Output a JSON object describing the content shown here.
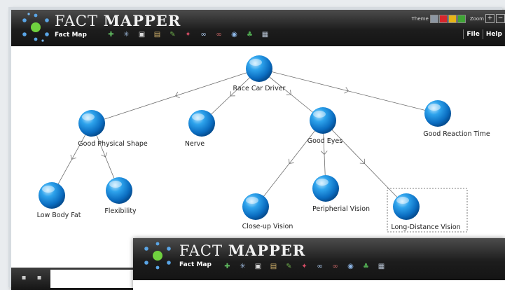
{
  "app": {
    "title_light": "FACT",
    "title_bold": "MAPPER",
    "subtitle": "Fact Map",
    "theme_label": "Theme",
    "zoom_label": "Zoom",
    "zoom_in": "+",
    "zoom_out": "−",
    "theme_colors": [
      "#8d97a3",
      "#d8262c",
      "#e7b416",
      "#3fa535"
    ],
    "menu": [
      "File",
      "Help"
    ],
    "toolbar_icons": [
      {
        "name": "add-fact-icon",
        "glyph": "✚",
        "color": "#5fb85f"
      },
      {
        "name": "spark-icon",
        "glyph": "✳",
        "color": "#9bb6d8"
      },
      {
        "name": "clipboard-icon",
        "glyph": "▣",
        "color": "#d9d9d9"
      },
      {
        "name": "paste-icon",
        "glyph": "▤",
        "color": "#d7b66e"
      },
      {
        "name": "pencil-icon",
        "glyph": "✎",
        "color": "#6fb04c"
      },
      {
        "name": "pin-icon",
        "glyph": "✦",
        "color": "#d84e66"
      },
      {
        "name": "link-icon",
        "glyph": "∞",
        "color": "#a9c6e8"
      },
      {
        "name": "unlink-icon",
        "glyph": "∞",
        "color": "#c96666"
      },
      {
        "name": "eye-icon",
        "glyph": "◉",
        "color": "#8fb8e8"
      },
      {
        "name": "hierarchy-icon",
        "glyph": "♣",
        "color": "#4fa650"
      },
      {
        "name": "document-icon",
        "glyph": "▦",
        "color": "#b8c4d4"
      }
    ]
  },
  "map": {
    "nodes": [
      {
        "id": "race-car-driver",
        "label": "Race Car Driver"
      },
      {
        "id": "good-physical-shape",
        "label": "Good Physical Shape"
      },
      {
        "id": "nerve",
        "label": "Nerve"
      },
      {
        "id": "good-eyes",
        "label": "Good Eyes"
      },
      {
        "id": "good-reaction-time",
        "label": "Good Reaction Time"
      },
      {
        "id": "low-body-fat",
        "label": "Low Body Fat"
      },
      {
        "id": "flexibility",
        "label": "Flexibility"
      },
      {
        "id": "close-up-vision",
        "label": "Close-up Vision"
      },
      {
        "id": "peripheral-vision",
        "label": "Peripherial Vision"
      },
      {
        "id": "long-distance-vision",
        "label": "Long-Distance Vision",
        "selected": true
      }
    ],
    "edges": [
      [
        "race-car-driver",
        "good-physical-shape"
      ],
      [
        "race-car-driver",
        "nerve"
      ],
      [
        "race-car-driver",
        "good-eyes"
      ],
      [
        "race-car-driver",
        "good-reaction-time"
      ],
      [
        "good-physical-shape",
        "low-body-fat"
      ],
      [
        "good-physical-shape",
        "flexibility"
      ],
      [
        "good-eyes",
        "close-up-vision"
      ],
      [
        "good-eyes",
        "peripheral-vision"
      ],
      [
        "good-eyes",
        "long-distance-vision"
      ]
    ]
  },
  "bottom_bar": {
    "save_icon": "▪",
    "delete_icon": "▪",
    "input_value": ""
  },
  "second_window": {
    "title_light": "FACT",
    "title_bold": "MAPPER",
    "subtitle": "Fact Map"
  }
}
